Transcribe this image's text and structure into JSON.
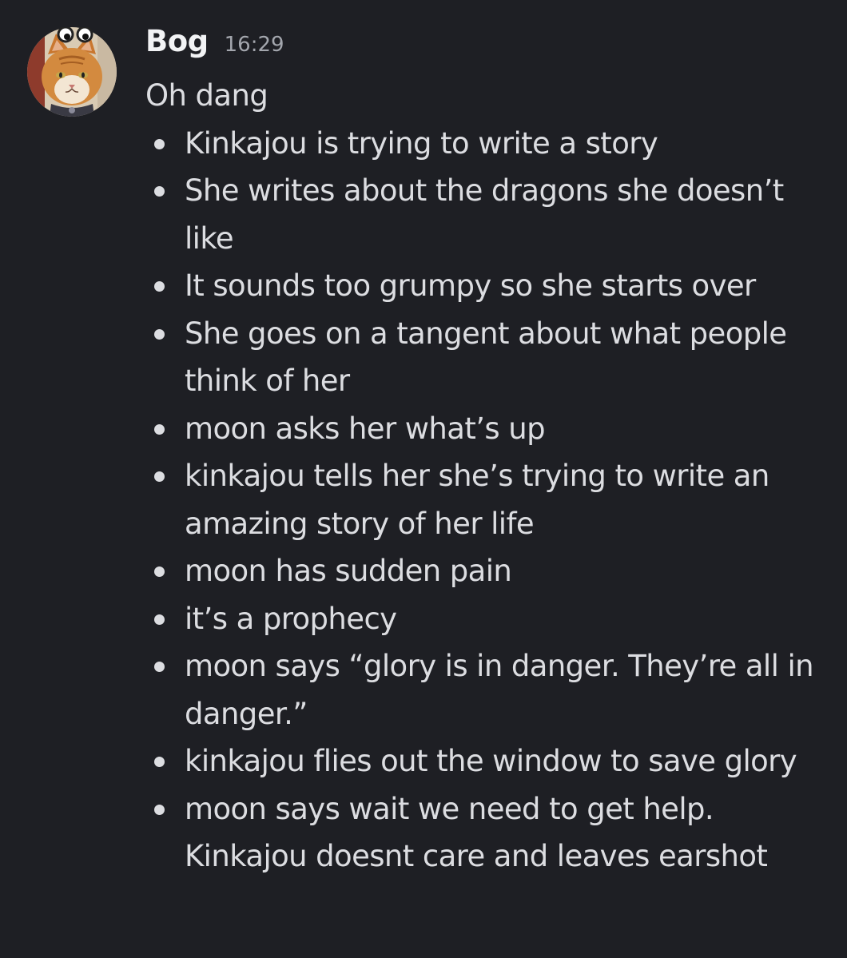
{
  "message": {
    "author": "Bog",
    "timestamp": "16:29",
    "first_line": "Oh dang",
    "avatar_icon": "cat-avatar-with-googly-eyes-icon",
    "bullets": [
      "Kinkajou is trying to write a story",
      "She writes about the dragons she doesn’t like",
      "It sounds too grumpy so she starts over",
      "She goes on a tangent about what people think of her",
      "moon asks her what’s up",
      "kinkajou tells her she’s trying to write an amazing story of her life",
      "moon has sudden pain",
      "it’s a prophecy",
      "moon says “glory is in danger. They’re all in danger.”",
      "kinkajou flies out the window to save glory",
      "moon says wait we need to get help. Kinkajou doesnt care and leaves earshot"
    ]
  },
  "colors": {
    "background": "#1e1f24",
    "text": "#dcdde1",
    "author": "#f2f3f5",
    "timestamp": "#a3a6ad"
  }
}
